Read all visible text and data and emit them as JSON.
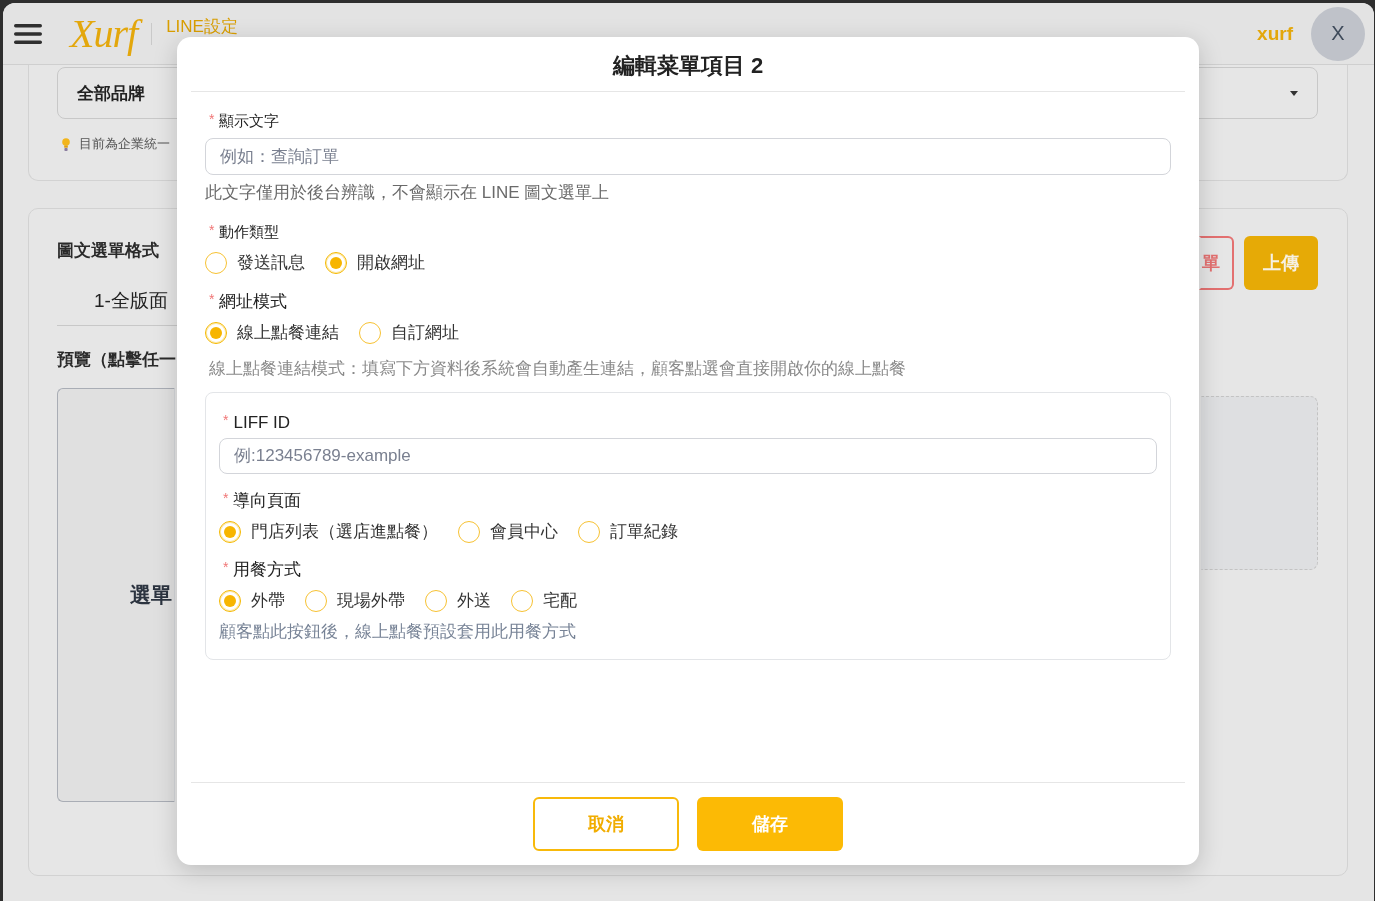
{
  "header": {
    "logo": "Xurf",
    "section_title": "LINE設定",
    "user_name": "xurf",
    "avatar_initial": "X"
  },
  "brand_card": {
    "select_value": "全部品牌",
    "hint": "目前為企業統一"
  },
  "menu_card": {
    "format_label": "圖文選單格式",
    "format_value": "1-全版面",
    "preview_label": "預覽（點擊任一",
    "preview_text": "選單",
    "buttons": [
      {
        "label": "單",
        "kind": "danger"
      },
      {
        "label": "上傳",
        "kind": "primary"
      }
    ]
  },
  "modal": {
    "title": "編輯菜單項目 2",
    "fields": [
      {
        "kind": "text",
        "required_mark": "*",
        "label": "顯示文字",
        "placeholder": "例如：查詢訂單",
        "hint": "此文字僅用於後台辨識，不會顯示在 LINE 圖文選單上"
      },
      {
        "kind": "radio",
        "required_mark": "*",
        "label": "動作類型",
        "options": [
          {
            "label": "發送訊息",
            "selected": false
          },
          {
            "label": "開啟網址",
            "selected": true
          }
        ]
      },
      {
        "kind": "radio",
        "required_mark": "*",
        "label": "網址模式",
        "options": [
          {
            "label": "線上點餐連結",
            "selected": true
          },
          {
            "label": "自訂網址",
            "selected": false
          }
        ],
        "hint": "線上點餐連結模式：填寫下方資料後系統會自動產生連結，顧客點選會直接開啟你的線上點餐"
      },
      {
        "kind": "group",
        "fields": [
          {
            "kind": "text",
            "required_mark": "*",
            "label": "LIFF ID",
            "placeholder": "例:123456789-example"
          },
          {
            "kind": "radio",
            "required_mark": "*",
            "label": "導向頁面",
            "options": [
              {
                "label": "門店列表（選店進點餐）",
                "selected": true
              },
              {
                "label": "會員中心",
                "selected": false
              },
              {
                "label": "訂單紀錄",
                "selected": false
              }
            ]
          },
          {
            "kind": "radio",
            "required_mark": "*",
            "label": "用餐方式",
            "options": [
              {
                "label": "外帶",
                "selected": true
              },
              {
                "label": "現場外帶",
                "selected": false
              },
              {
                "label": "外送",
                "selected": false
              },
              {
                "label": "宅配",
                "selected": false
              }
            ],
            "hint": "顧客點此按鈕後，線上點餐預設套用此用餐方式"
          }
        ]
      }
    ],
    "buttons": [
      {
        "label": "取消",
        "kind": "outline"
      },
      {
        "label": "儲存",
        "kind": "primary"
      }
    ]
  }
}
